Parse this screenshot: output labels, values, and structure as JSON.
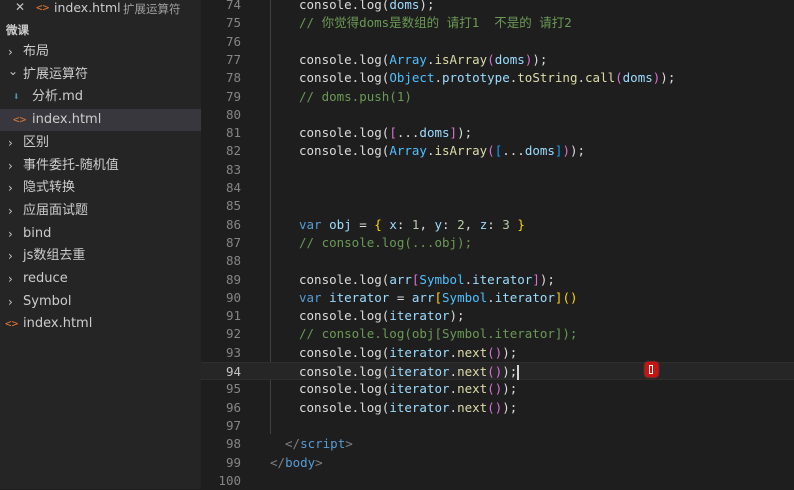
{
  "open_tab": {
    "close_glyph": "✕",
    "icon_glyph": "<>",
    "name": "index.html",
    "folder": "扩展运算符"
  },
  "explorer": {
    "section_title": "微课",
    "items": [
      {
        "label": "布局",
        "kind": "folder",
        "expanded": false,
        "icon": "chevron-right-icon"
      },
      {
        "label": "扩展运算符",
        "kind": "folder",
        "expanded": true,
        "icon": "chevron-down-icon"
      },
      {
        "label": "分析.md",
        "kind": "file",
        "icon": "markdown-file-icon"
      },
      {
        "label": "index.html",
        "kind": "file",
        "icon": "html-file-icon",
        "selected": true
      },
      {
        "label": "区别",
        "kind": "folder",
        "expanded": false,
        "icon": "chevron-right-icon"
      },
      {
        "label": "事件委托-随机值",
        "kind": "folder",
        "expanded": false,
        "icon": "chevron-right-icon"
      },
      {
        "label": "隐式转换",
        "kind": "folder",
        "expanded": false,
        "icon": "chevron-right-icon"
      },
      {
        "label": "应届面试题",
        "kind": "folder",
        "expanded": false,
        "icon": "chevron-right-icon"
      },
      {
        "label": "bind",
        "kind": "folder",
        "expanded": false,
        "icon": "chevron-right-icon"
      },
      {
        "label": "js数组去重",
        "kind": "folder",
        "expanded": false,
        "icon": "chevron-right-icon"
      },
      {
        "label": "reduce",
        "kind": "folder",
        "expanded": false,
        "icon": "chevron-right-icon"
      },
      {
        "label": "Symbol",
        "kind": "folder",
        "expanded": false,
        "icon": "chevron-right-icon"
      },
      {
        "label": "index.html",
        "kind": "file",
        "icon": "html-file-icon"
      }
    ]
  },
  "editor": {
    "current_line": 94,
    "lines": [
      {
        "n": "74",
        "tokens": [
          [
            "t-ident",
            "console.log("
          ],
          [
            "t-var",
            "doms"
          ],
          [
            "t-ident",
            ");"
          ]
        ]
      },
      {
        "n": "75",
        "tokens": [
          [
            "t-cmt",
            "// 你觉得doms是数组的 请打1  不是的 请打2"
          ]
        ]
      },
      {
        "n": "76",
        "tokens": []
      },
      {
        "n": "77",
        "tokens": [
          [
            "t-ident",
            "console.log("
          ],
          [
            "t-obj",
            "Array"
          ],
          [
            "t-ident",
            "."
          ],
          [
            "t-fn",
            "isArray"
          ],
          [
            "t-brk2",
            "("
          ],
          [
            "t-var",
            "doms"
          ],
          [
            "t-brk2",
            ")"
          ],
          [
            "t-ident",
            ");"
          ]
        ]
      },
      {
        "n": "78",
        "tokens": [
          [
            "t-ident",
            "console.log("
          ],
          [
            "t-obj",
            "Object"
          ],
          [
            "t-ident",
            "."
          ],
          [
            "t-var",
            "prototype"
          ],
          [
            "t-ident",
            "."
          ],
          [
            "t-fn",
            "toString"
          ],
          [
            "t-ident",
            "."
          ],
          [
            "t-fn",
            "call"
          ],
          [
            "t-brk2",
            "("
          ],
          [
            "t-var",
            "doms"
          ],
          [
            "t-brk2",
            ")"
          ],
          [
            "t-ident",
            ");"
          ]
        ]
      },
      {
        "n": "79",
        "tokens": [
          [
            "t-cmt",
            "// doms.push(1)"
          ]
        ]
      },
      {
        "n": "80",
        "tokens": []
      },
      {
        "n": "81",
        "tokens": [
          [
            "t-ident",
            "console.log("
          ],
          [
            "t-brk2",
            "["
          ],
          [
            "t-ident",
            "..."
          ],
          [
            "t-var",
            "doms"
          ],
          [
            "t-brk2",
            "]"
          ],
          [
            "t-ident",
            ");"
          ]
        ]
      },
      {
        "n": "82",
        "tokens": [
          [
            "t-ident",
            "console.log("
          ],
          [
            "t-obj",
            "Array"
          ],
          [
            "t-ident",
            "."
          ],
          [
            "t-fn",
            "isArray"
          ],
          [
            "t-brk2",
            "("
          ],
          [
            "t-brk3",
            "["
          ],
          [
            "t-ident",
            "..."
          ],
          [
            "t-var",
            "doms"
          ],
          [
            "t-brk3",
            "]"
          ],
          [
            "t-brk2",
            ")"
          ],
          [
            "t-ident",
            ");"
          ]
        ]
      },
      {
        "n": "83",
        "tokens": []
      },
      {
        "n": "84",
        "tokens": []
      },
      {
        "n": "85",
        "tokens": []
      },
      {
        "n": "86",
        "tokens": [
          [
            "t-kw",
            "var "
          ],
          [
            "t-var",
            "obj"
          ],
          [
            "t-ident",
            " = "
          ],
          [
            "t-brk1",
            "{ "
          ],
          [
            "t-var",
            "x"
          ],
          [
            "t-ident",
            ": "
          ],
          [
            "t-num",
            "1"
          ],
          [
            "t-ident",
            ", "
          ],
          [
            "t-var",
            "y"
          ],
          [
            "t-ident",
            ": "
          ],
          [
            "t-num",
            "2"
          ],
          [
            "t-ident",
            ", "
          ],
          [
            "t-var",
            "z"
          ],
          [
            "t-ident",
            ": "
          ],
          [
            "t-num",
            "3"
          ],
          [
            "t-brk1",
            " }"
          ]
        ]
      },
      {
        "n": "87",
        "tokens": [
          [
            "t-cmt",
            "// console.log(...obj);"
          ]
        ]
      },
      {
        "n": "88",
        "tokens": []
      },
      {
        "n": "89",
        "tokens": [
          [
            "t-ident",
            "console.log("
          ],
          [
            "t-var",
            "arr"
          ],
          [
            "t-brk2",
            "["
          ],
          [
            "t-obj",
            "Symbol"
          ],
          [
            "t-ident",
            "."
          ],
          [
            "t-var",
            "iterator"
          ],
          [
            "t-brk2",
            "]"
          ],
          [
            "t-ident",
            ");"
          ]
        ]
      },
      {
        "n": "90",
        "tokens": [
          [
            "t-kw",
            "var "
          ],
          [
            "t-var",
            "iterator"
          ],
          [
            "t-ident",
            " = "
          ],
          [
            "t-var",
            "arr"
          ],
          [
            "t-brk1",
            "["
          ],
          [
            "t-obj",
            "Symbol"
          ],
          [
            "t-ident",
            "."
          ],
          [
            "t-var",
            "iterator"
          ],
          [
            "t-brk1",
            "]"
          ],
          [
            "t-brk1",
            "()"
          ]
        ]
      },
      {
        "n": "91",
        "tokens": [
          [
            "t-ident",
            "console.log("
          ],
          [
            "t-var",
            "iterator"
          ],
          [
            "t-ident",
            ");"
          ]
        ]
      },
      {
        "n": "92",
        "tokens": [
          [
            "t-cmt",
            "// console.log(obj[Symbol.iterator]);"
          ]
        ]
      },
      {
        "n": "93",
        "tokens": [
          [
            "t-ident",
            "console.log("
          ],
          [
            "t-var",
            "iterator"
          ],
          [
            "t-ident",
            "."
          ],
          [
            "t-fn",
            "next"
          ],
          [
            "t-brk2",
            "()"
          ],
          [
            "t-ident",
            ");"
          ]
        ]
      },
      {
        "n": "94",
        "tokens": [
          [
            "t-ident",
            "console.log("
          ],
          [
            "t-var",
            "iterator"
          ],
          [
            "t-ident",
            "."
          ],
          [
            "t-fn",
            "next"
          ],
          [
            "t-brk2",
            "()"
          ],
          [
            "t-ident",
            ");"
          ]
        ],
        "cursor": true
      },
      {
        "n": "95",
        "tokens": [
          [
            "t-ident",
            "console.log("
          ],
          [
            "t-var",
            "iterator"
          ],
          [
            "t-ident",
            "."
          ],
          [
            "t-fn",
            "next"
          ],
          [
            "t-brk2",
            "()"
          ],
          [
            "t-ident",
            ");"
          ]
        ]
      },
      {
        "n": "96",
        "tokens": [
          [
            "t-ident",
            "console.log("
          ],
          [
            "t-var",
            "iterator"
          ],
          [
            "t-ident",
            "."
          ],
          [
            "t-fn",
            "next"
          ],
          [
            "t-brk2",
            "()"
          ],
          [
            "t-ident",
            ");"
          ]
        ]
      },
      {
        "n": "97",
        "tokens": []
      },
      {
        "n": "98",
        "tokens": [
          [
            "t-tag",
            "</"
          ],
          [
            "t-tagname",
            "script"
          ],
          [
            "t-tag",
            ">"
          ]
        ],
        "indent": 1
      },
      {
        "n": "99",
        "tokens": [
          [
            "t-tag",
            "</"
          ],
          [
            "t-tagname",
            "body"
          ],
          [
            "t-tag",
            ">"
          ]
        ],
        "indent": 0
      },
      {
        "n": "100",
        "tokens": []
      }
    ]
  },
  "colors": {
    "sidebar_bg": "#252526",
    "editor_bg": "#1e1e1e",
    "html_icon": "#e37933",
    "markdown_icon": "#519aba"
  }
}
